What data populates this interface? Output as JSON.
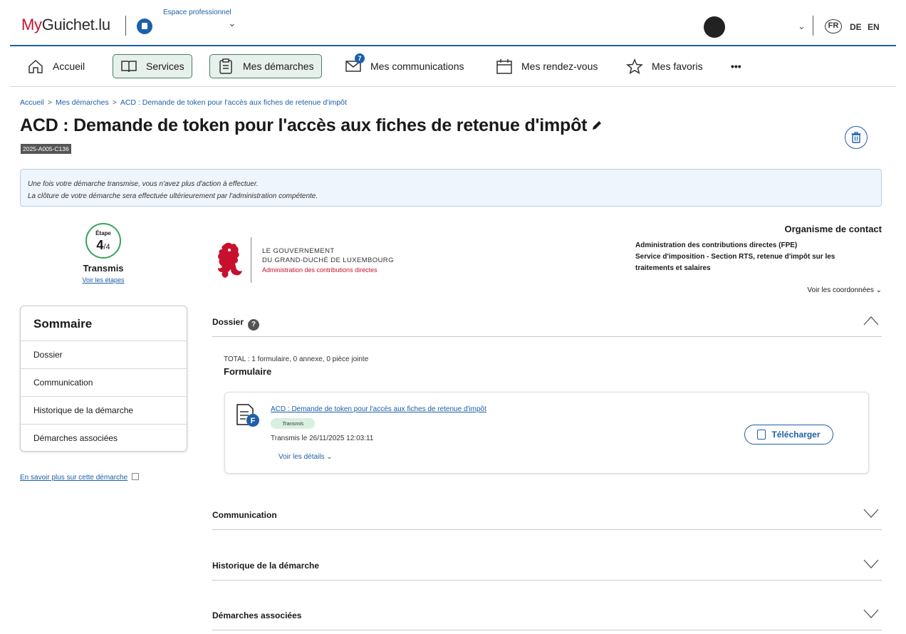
{
  "header": {
    "brand_my": "My",
    "brand_rest": "Guichet.lu",
    "space_label": "Espace professionnel",
    "languages": [
      "FR",
      "DE",
      "EN"
    ]
  },
  "nav": {
    "items": [
      {
        "label": "Accueil",
        "icon": "home-icon"
      },
      {
        "label": "Services",
        "icon": "book-icon"
      },
      {
        "label": "Mes démarches",
        "icon": "clipboard-icon"
      },
      {
        "label": "Mes communications",
        "icon": "mail-icon",
        "badge": "7"
      },
      {
        "label": "Mes rendez-vous",
        "icon": "calendar-icon"
      },
      {
        "label": "Mes favoris",
        "icon": "star-icon"
      }
    ],
    "more": "•••"
  },
  "breadcrumb": [
    "Accueil",
    "Mes démarches",
    "ACD : Demande de token pour l'accès aux fiches de retenue d'impôt"
  ],
  "page": {
    "title": "ACD : Demande de token pour l'accès aux fiches de retenue d'impôt",
    "reference": "2025-A005-C136"
  },
  "banner": {
    "line1": "Une fois votre démarche transmise, vous n'avez plus d'action à effectuer.",
    "line2": "La clôture de votre démarche sera effectuée ultérieurement par l'administration compétente."
  },
  "step": {
    "label": "Étape",
    "current": "4",
    "total": "/4",
    "status": "Transmis",
    "link": "Voir les étapes"
  },
  "gov": {
    "line1": "LE GOUVERNEMENT",
    "line2": "DU GRAND-DUCHÉ DE LUXEMBOURG",
    "line3": "Administration des contributions directes"
  },
  "contact": {
    "title": "Organisme de contact",
    "org1": "Administration des contributions directes (FPE)",
    "org2": "Service d'imposition - Section RTS, retenue d'impôt sur les traitements et salaires",
    "link": "Voir les coordonnées"
  },
  "sommaire": {
    "title": "Sommaire",
    "items": [
      "Dossier",
      "Communication",
      "Historique de la démarche",
      "Démarches associées"
    ],
    "more_link": "En savoir plus sur cette démarche"
  },
  "dossier": {
    "label": "Dossier",
    "help": "?",
    "total": "TOTAL : 1 formulaire, 0 annexe, 0 pièce jointe",
    "form_heading": "Formulaire",
    "card": {
      "title": "ACD : Demande de token pour l'accès aux fiches de retenue d'impôt",
      "badge": "Transmis",
      "date": "Transmis le 26/11/2025 12:03:11",
      "details": "Voir les détails",
      "download": "Télécharger",
      "icon_letter": "F"
    }
  },
  "sections": [
    "Communication",
    "Historique de la démarche",
    "Démarches associées"
  ],
  "colors": {
    "brand_red": "#c8102e",
    "link_blue": "#1d5fa8",
    "step_green": "#3aa35a"
  }
}
